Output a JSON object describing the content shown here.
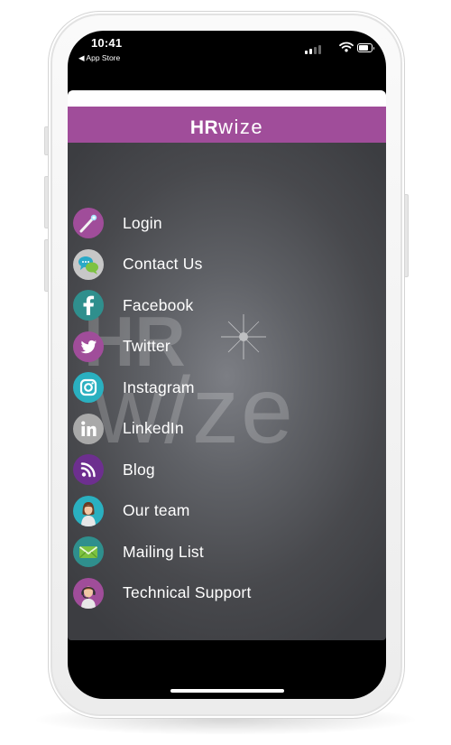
{
  "status_bar": {
    "time": "10:41",
    "back_label": "◀ App Store",
    "signal_icon": "cellular-signal-icon",
    "wifi_icon": "wifi-icon",
    "battery_icon": "battery-icon"
  },
  "header": {
    "brand_hr": "HR",
    "brand_wize": "wize",
    "brand_color": "#a04d9a"
  },
  "watermark": {
    "hr": "HR",
    "wize": "w/ze"
  },
  "menu": [
    {
      "label": "Login",
      "icon": "magic-wand-icon",
      "color": "#a04d9a"
    },
    {
      "label": "Contact Us",
      "icon": "chat-bubbles-icon",
      "color": "#bdbdbd"
    },
    {
      "label": "Facebook",
      "icon": "facebook-icon",
      "color": "#2f8f8d"
    },
    {
      "label": "Twitter",
      "icon": "twitter-icon",
      "color": "#a04d9a"
    },
    {
      "label": "Instagram",
      "icon": "instagram-icon",
      "color": "#2ab0c0"
    },
    {
      "label": "LinkedIn",
      "icon": "linkedin-icon",
      "color": "#a9a9a9"
    },
    {
      "label": "Blog",
      "icon": "rss-icon",
      "color": "#6d2f8f"
    },
    {
      "label": "Our team",
      "icon": "team-member-icon",
      "color": "#2ab0c0"
    },
    {
      "label": "Mailing List",
      "icon": "envelope-icon",
      "color": "#2f8f8d"
    },
    {
      "label": "Technical Support",
      "icon": "support-agent-icon",
      "color": "#a04d9a"
    }
  ]
}
